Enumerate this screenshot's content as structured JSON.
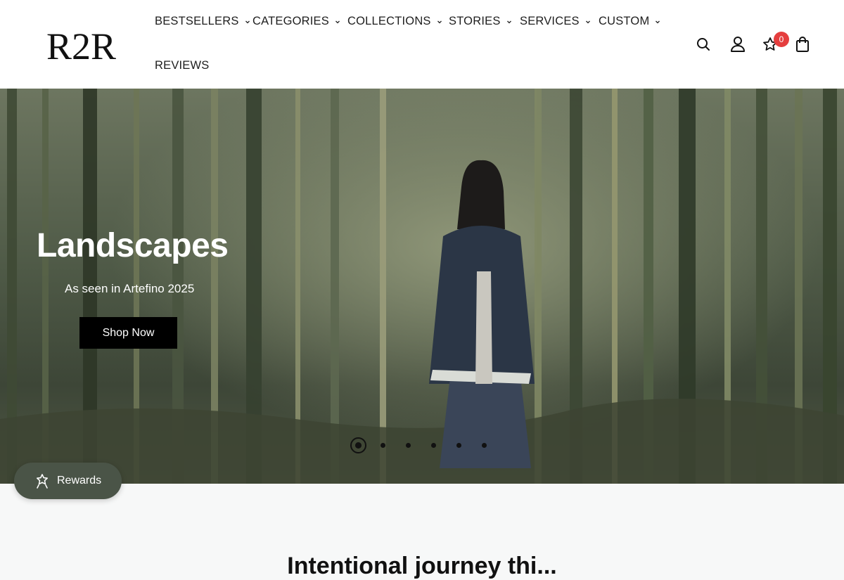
{
  "brand": {
    "logo_text": "R2R"
  },
  "nav": {
    "items": [
      {
        "label": "BESTSELLERS",
        "has_dropdown": true
      },
      {
        "label": "CATEGORIES",
        "has_dropdown": true
      },
      {
        "label": "COLLECTIONS",
        "has_dropdown": true
      },
      {
        "label": "STORIES",
        "has_dropdown": true
      },
      {
        "label": "SERVICES",
        "has_dropdown": true
      },
      {
        "label": "CUSTOM",
        "has_dropdown": true
      },
      {
        "label": "REVIEWS",
        "has_dropdown": false
      }
    ]
  },
  "header_icons": {
    "search": "search-icon",
    "account": "user-icon",
    "wishlist": "star-icon",
    "wishlist_count": "0",
    "cart": "shopping-bag-icon"
  },
  "hero": {
    "title": "Landscapes",
    "subtitle": "As seen in Artefino 2025",
    "cta_label": "Shop Now",
    "slide_count": 6,
    "active_slide": 1
  },
  "rewards": {
    "label": "Rewards",
    "icon": "gift-icon"
  },
  "next_section": {
    "heading": "Intentional journey thi..."
  },
  "colors": {
    "badge": "#e53e3e",
    "rewards_bg": "#4a5447",
    "cta_bg": "#000000"
  }
}
